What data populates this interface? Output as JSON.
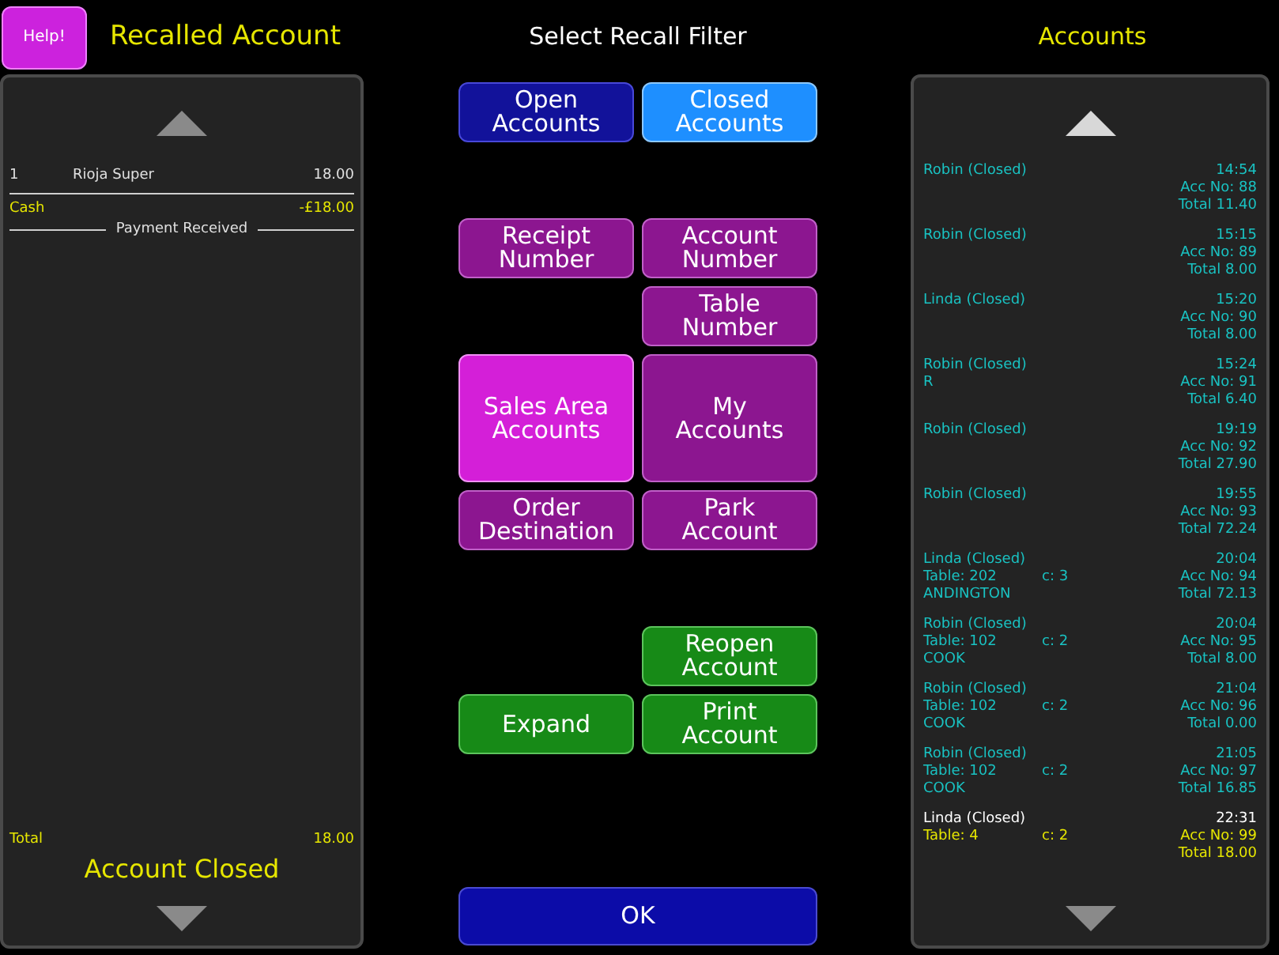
{
  "help_button": "Help!",
  "left_panel": {
    "title": "Recalled Account",
    "items": [
      {
        "qty": "1",
        "name": "Rioja Super",
        "price": "18.00"
      }
    ],
    "payment": {
      "name": "Cash",
      "amount": "-£18.00"
    },
    "payment_divider": "Payment Received",
    "total": {
      "label": "Total",
      "amount": "18.00"
    },
    "status": "Account Closed"
  },
  "filter_panel": {
    "title": "Select Recall Filter",
    "buttons": [
      {
        "label": "Open Accounts",
        "kind": "status_filter",
        "selected": false
      },
      {
        "label": "Closed Accounts",
        "kind": "status_filter",
        "selected": true
      },
      {
        "label": "Receipt Number",
        "kind": "filter",
        "selected": false
      },
      {
        "label": "Account Number",
        "kind": "filter",
        "selected": false
      },
      {
        "label": "Table Number",
        "kind": "filter",
        "selected": false
      },
      {
        "label": "Sales Area Accounts",
        "kind": "filter",
        "selected": true
      },
      {
        "label": "My Accounts",
        "kind": "filter",
        "selected": false
      },
      {
        "label": "Order Destination",
        "kind": "filter",
        "selected": false
      },
      {
        "label": "Park Account",
        "kind": "filter",
        "selected": false
      },
      {
        "label": "Reopen Account",
        "kind": "action"
      },
      {
        "label": "Expand",
        "kind": "action"
      },
      {
        "label": "Print Account",
        "kind": "action"
      }
    ],
    "ok_button": "OK"
  },
  "accounts_panel": {
    "title": "Accounts",
    "accounts": [
      {
        "name": "Robin (Closed)",
        "time": "14:54",
        "acc_no": "Acc No: 88",
        "total": "Total 11.40",
        "selected": false
      },
      {
        "name": "Robin (Closed)",
        "time": "15:15",
        "acc_no": "Acc No: 89",
        "total": "Total 8.00",
        "selected": false
      },
      {
        "name": "Linda (Closed)",
        "time": "15:20",
        "acc_no": "Acc No: 90",
        "total": "Total 8.00",
        "selected": false
      },
      {
        "name": "Robin (Closed)",
        "time": "15:24",
        "acc_no": "Acc No: 91",
        "customer": "R",
        "total": "Total 6.40",
        "selected": false
      },
      {
        "name": "Robin (Closed)",
        "time": "19:19",
        "acc_no": "Acc No: 92",
        "total": "Total 27.90",
        "selected": false
      },
      {
        "name": "Robin (Closed)",
        "time": "19:55",
        "acc_no": "Acc No: 93",
        "total": "Total 72.24",
        "selected": false
      },
      {
        "name": "Linda (Closed)",
        "time": "20:04",
        "table": "Table: 202",
        "covers": "c: 3",
        "acc_no": "Acc No: 94",
        "customer": "ANDINGTON",
        "total": "Total 72.13",
        "selected": false
      },
      {
        "name": "Robin (Closed)",
        "time": "20:04",
        "table": "Table: 102",
        "covers": "c: 2",
        "acc_no": "Acc No: 95",
        "customer": "COOK",
        "total": "Total 8.00",
        "selected": false
      },
      {
        "name": "Robin (Closed)",
        "time": "21:04",
        "table": "Table: 102",
        "covers": "c: 2",
        "acc_no": "Acc No: 96",
        "customer": "COOK",
        "total": "Total 0.00",
        "selected": false
      },
      {
        "name": "Robin (Closed)",
        "time": "21:05",
        "table": "Table: 102",
        "covers": "c: 2",
        "acc_no": "Acc No: 97",
        "customer": "COOK",
        "total": "Total 16.85",
        "selected": false
      },
      {
        "name": "Linda (Closed)",
        "time": "22:31",
        "table": "Table: 4",
        "covers": "c: 2",
        "acc_no": "Acc No: 99",
        "total": "Total 18.00",
        "selected": true
      }
    ]
  }
}
